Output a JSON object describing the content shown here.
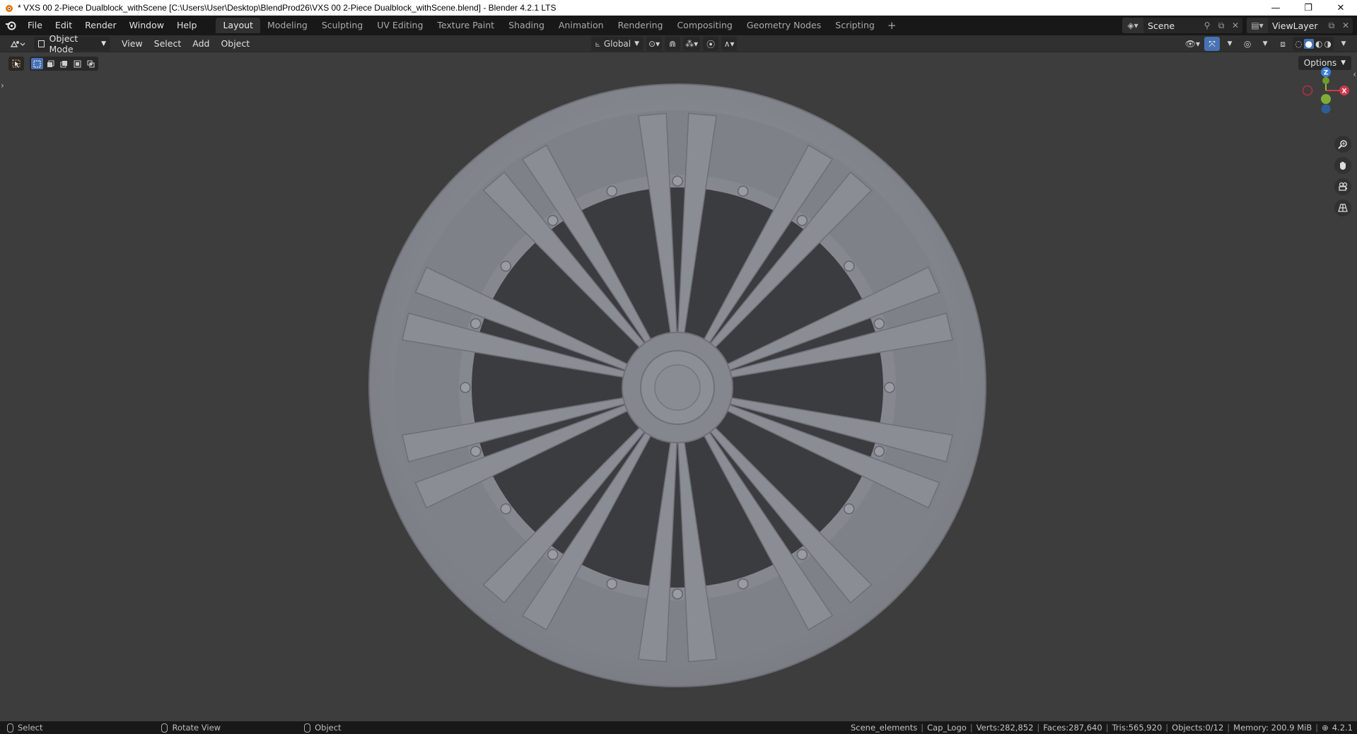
{
  "window": {
    "title": "* VXS 00 2-Piece Dualblock_withScene [C:\\Users\\User\\Desktop\\BlendProd26\\VXS 00 2-Piece Dualblock_withScene.blend] - Blender 4.2.1 LTS",
    "minimize": "—",
    "maximize": "❐",
    "close": "✕"
  },
  "topbar": {
    "menus": [
      "File",
      "Edit",
      "Render",
      "Window",
      "Help"
    ],
    "workspaces": [
      "Layout",
      "Modeling",
      "Sculpting",
      "UV Editing",
      "Texture Paint",
      "Shading",
      "Animation",
      "Rendering",
      "Compositing",
      "Geometry Nodes",
      "Scripting"
    ],
    "active_workspace": "Layout",
    "add_workspace": "+",
    "scene": "Scene",
    "view_layer": "ViewLayer"
  },
  "header": {
    "mode": "Object Mode",
    "menus": [
      "View",
      "Select",
      "Add",
      "Object"
    ],
    "transform_orientation": "Global"
  },
  "viewport": {
    "options_label": "Options",
    "gizmo_axes": [
      "Z",
      "X"
    ],
    "background_color": "#3d3d3d",
    "model_color": "#8b8d94"
  },
  "statusbar": {
    "actions": [
      {
        "label": "Select"
      },
      {
        "label": "Rotate View"
      },
      {
        "label": "Object"
      }
    ],
    "collection": "Scene_elements",
    "object": "Cap_Logo",
    "verts": "Verts:282,852",
    "faces": "Faces:287,640",
    "tris": "Tris:565,920",
    "objects": "Objects:0/12",
    "memory": "Memory: 200.9 MiB",
    "version": "4.2.1"
  },
  "colors": {
    "accent": "#4772b3",
    "x_axis": "#d2374a",
    "y_axis": "#8bc034",
    "z_axis": "#3b7fd6"
  }
}
